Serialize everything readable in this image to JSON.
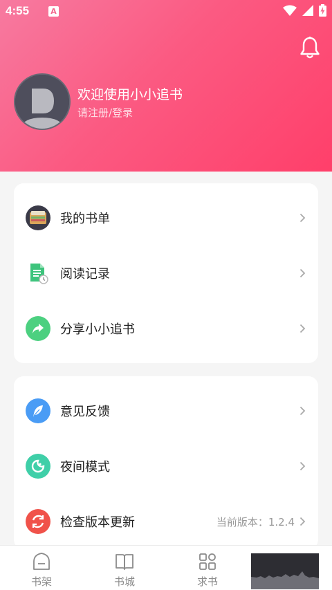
{
  "status_bar": {
    "time": "4:55",
    "badge": "A"
  },
  "header": {
    "welcome_text": "欢迎使用小小追书",
    "login_prompt": "请注册/登录",
    "gradient_colors": [
      "#f77aa0",
      "#ff3f6a"
    ]
  },
  "menu_group_1": [
    {
      "label": "我的书单",
      "icon": "book-list-icon",
      "color": "#3a3a48"
    },
    {
      "label": "阅读记录",
      "icon": "reading-history-icon",
      "color": "#3ec47c"
    },
    {
      "label": "分享小小追书",
      "icon": "share-icon",
      "color": "#4cd080"
    }
  ],
  "menu_group_2": [
    {
      "label": "意见反馈",
      "icon": "feedback-feather-icon",
      "color": "#4a9cf5"
    },
    {
      "label": "夜间模式",
      "icon": "night-mode-icon",
      "color": "#3fcfa8"
    },
    {
      "label": "检查版本更新",
      "icon": "update-refresh-icon",
      "color": "#f0524a",
      "value": "当前版本：1.2.4"
    }
  ],
  "tabs": [
    {
      "label": "书架",
      "icon": "bookshelf-icon"
    },
    {
      "label": "书城",
      "icon": "book-store-icon"
    },
    {
      "label": "求书",
      "icon": "request-book-icon"
    }
  ]
}
